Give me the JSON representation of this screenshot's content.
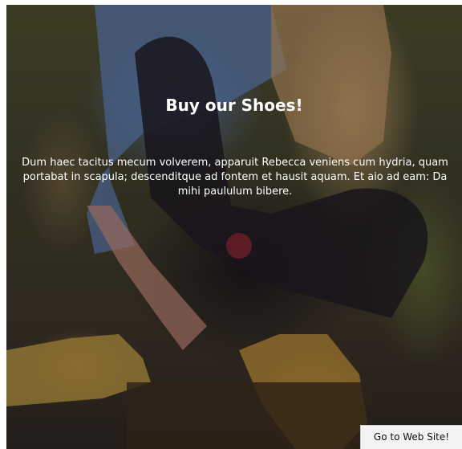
{
  "hero": {
    "title": "Buy our Shoes!",
    "description": "Dum haec tacitus mecum volverem, apparuit Rebecca veniens cum hydria, quam portabat in scapula; descenditque ad fontem et hausit aquam. Et aio ad eam: Da mihi paululum bibere."
  },
  "cta": {
    "label": "Go to Web Site!"
  },
  "colors": {
    "text": "#ffffff",
    "button_bg": "#f3f3f3"
  }
}
